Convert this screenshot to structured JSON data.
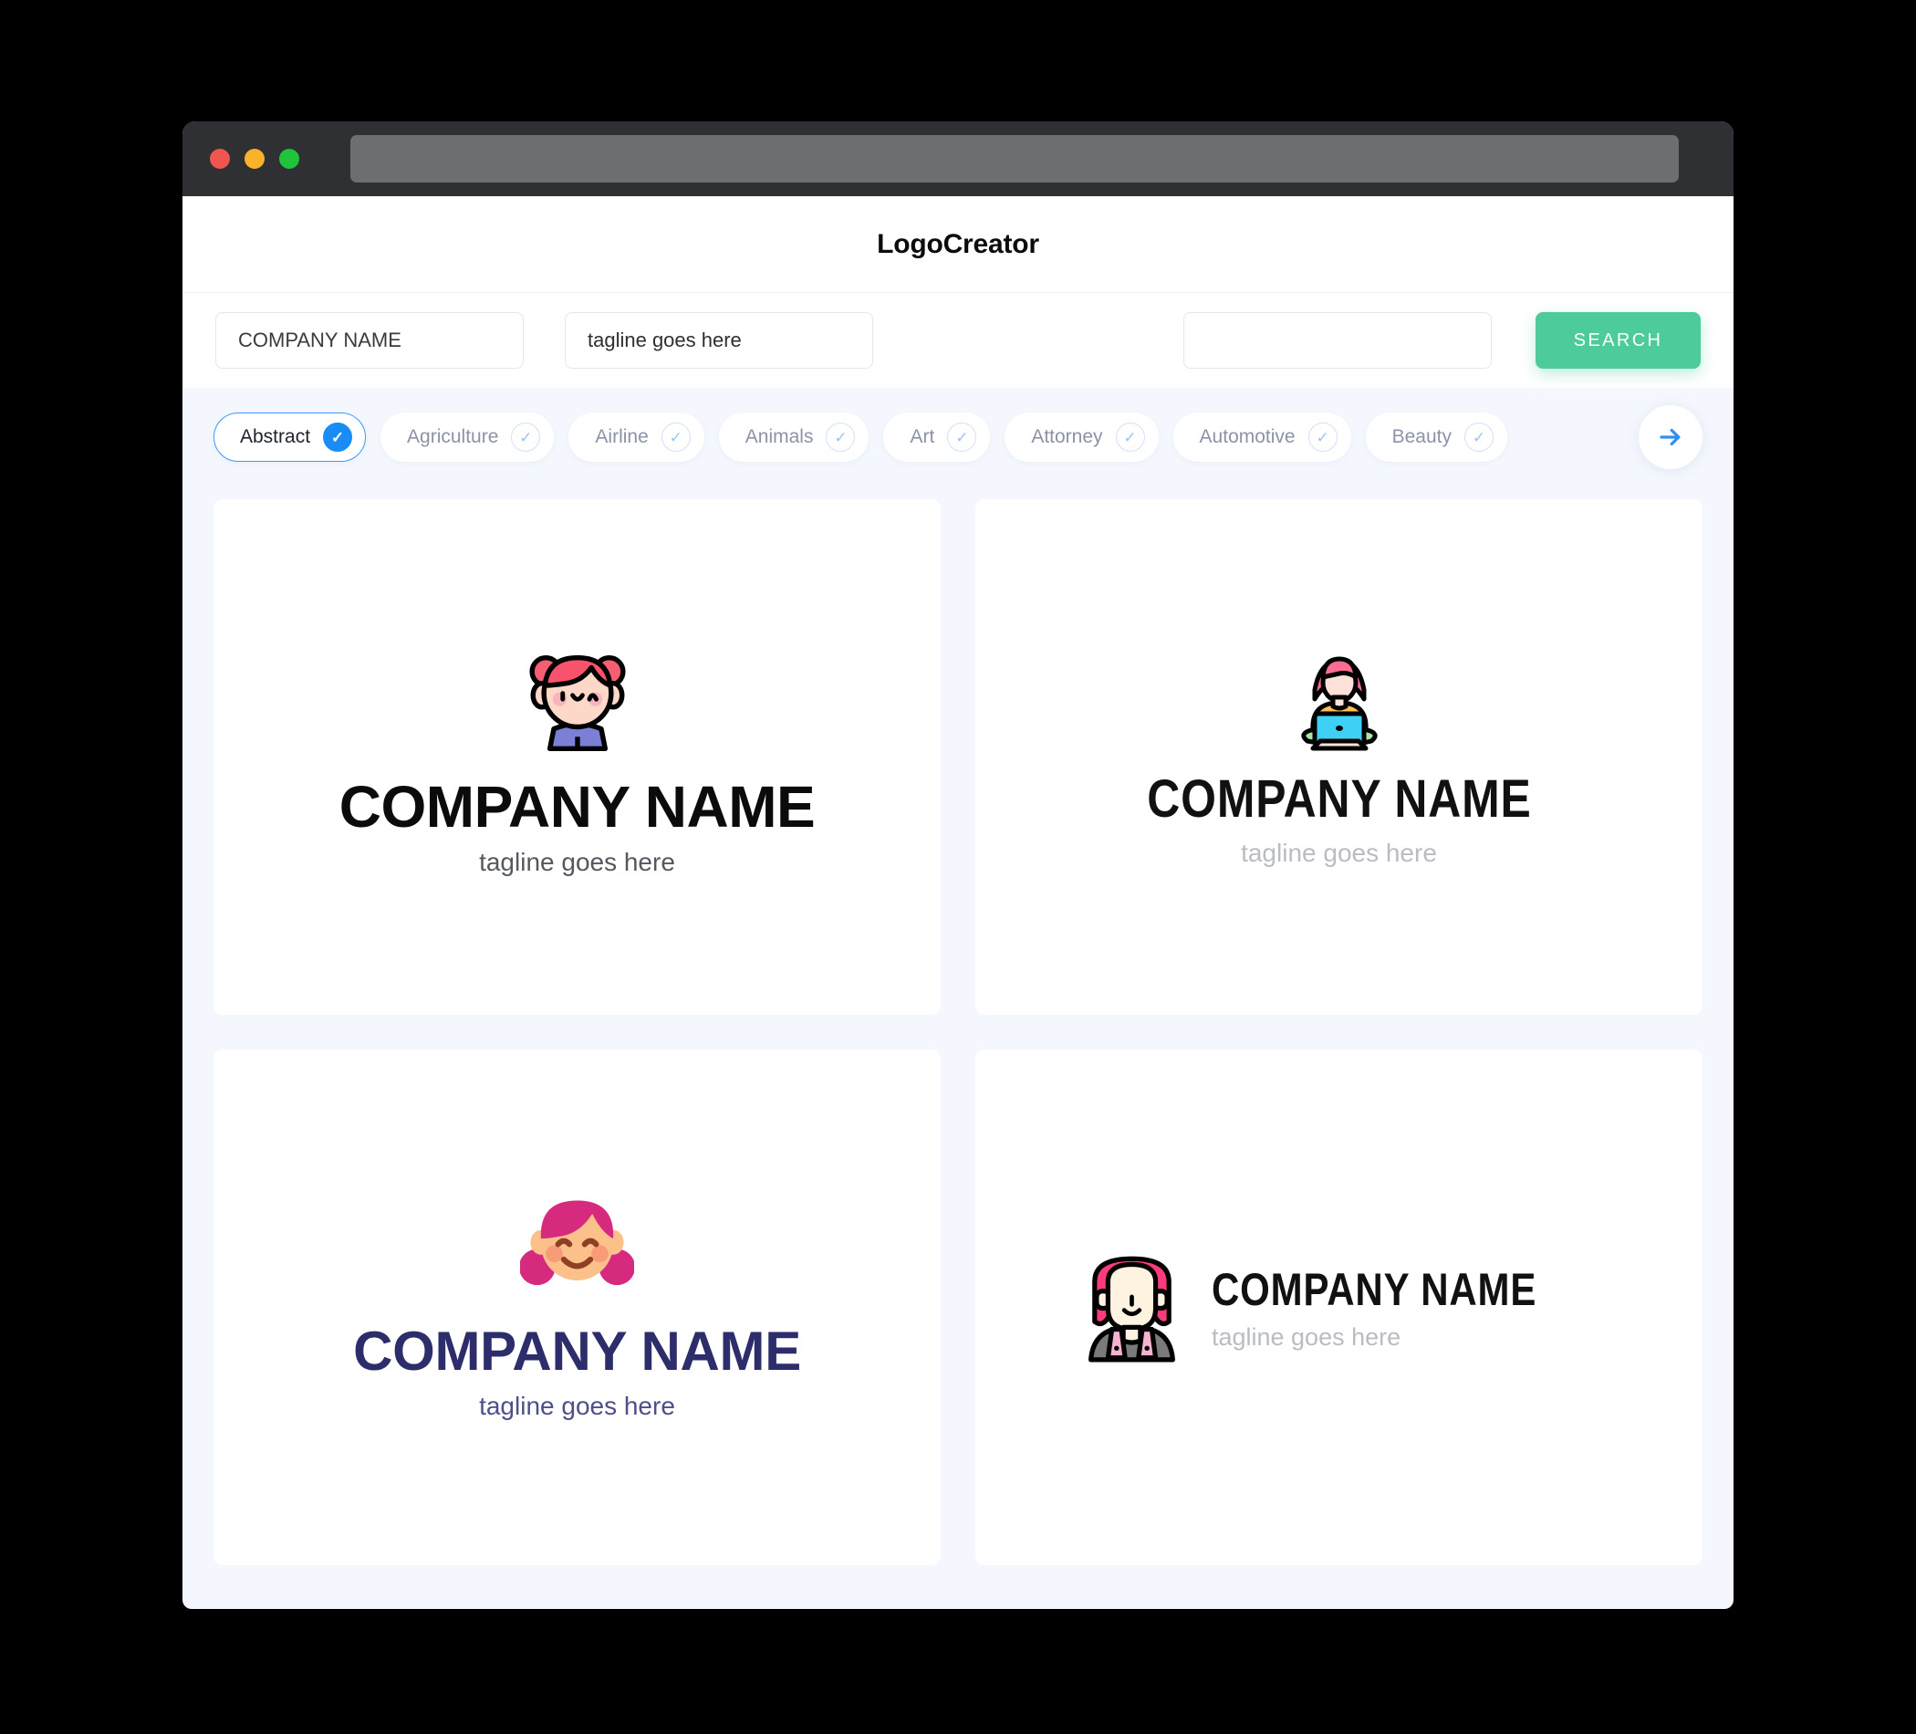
{
  "window": {
    "traffic_lights": [
      "close",
      "minimize",
      "maximize"
    ],
    "colors": {
      "close": "#f05550",
      "minimize": "#f9b229",
      "maximize": "#1fc43a",
      "chrome": "#2e3033",
      "url_bar": "#6d6e70",
      "page_background": "#f4f7fd",
      "accent_green": "#4ecb9b",
      "accent_blue": "#1a8cf5",
      "navy": "#2d2d6b"
    }
  },
  "header": {
    "title": "LogoCreator"
  },
  "search": {
    "company_value": "COMPANY NAME",
    "company_placeholder": "COMPANY NAME",
    "tagline_value": "tagline goes here",
    "tagline_placeholder": "tagline goes here",
    "keyword_value": "",
    "keyword_placeholder": "",
    "search_label": "SEARCH"
  },
  "categories": {
    "next_label": "next",
    "items": [
      {
        "label": "Abstract",
        "selected": true
      },
      {
        "label": "Agriculture",
        "selected": false
      },
      {
        "label": "Airline",
        "selected": false
      },
      {
        "label": "Animals",
        "selected": false
      },
      {
        "label": "Art",
        "selected": false
      },
      {
        "label": "Attorney",
        "selected": false
      },
      {
        "label": "Automotive",
        "selected": false
      },
      {
        "label": "Beauty",
        "selected": false
      }
    ]
  },
  "logos": [
    {
      "icon": "girl-with-hair-buns-icon",
      "name": "COMPANY NAME",
      "tagline": "tagline goes here",
      "layout": "stacked",
      "name_color": "#0b0b0b",
      "tagline_color": "#54585f"
    },
    {
      "icon": "woman-with-laptop-icon",
      "name": "COMPANY NAME",
      "tagline": "tagline goes here",
      "layout": "stacked",
      "name_color": "#111111",
      "tagline_color": "#b9bcc2"
    },
    {
      "icon": "smiling-girl-face-icon",
      "name": "COMPANY NAME",
      "tagline": "tagline goes here",
      "layout": "stacked",
      "name_color": "#2d2d6b",
      "tagline_color": "#4e4e8a"
    },
    {
      "icon": "woman-bob-haircut-icon",
      "name": "COMPANY NAME",
      "tagline": "tagline goes here",
      "layout": "horizontal",
      "name_color": "#111111",
      "tagline_color": "#b9bcc2"
    }
  ]
}
